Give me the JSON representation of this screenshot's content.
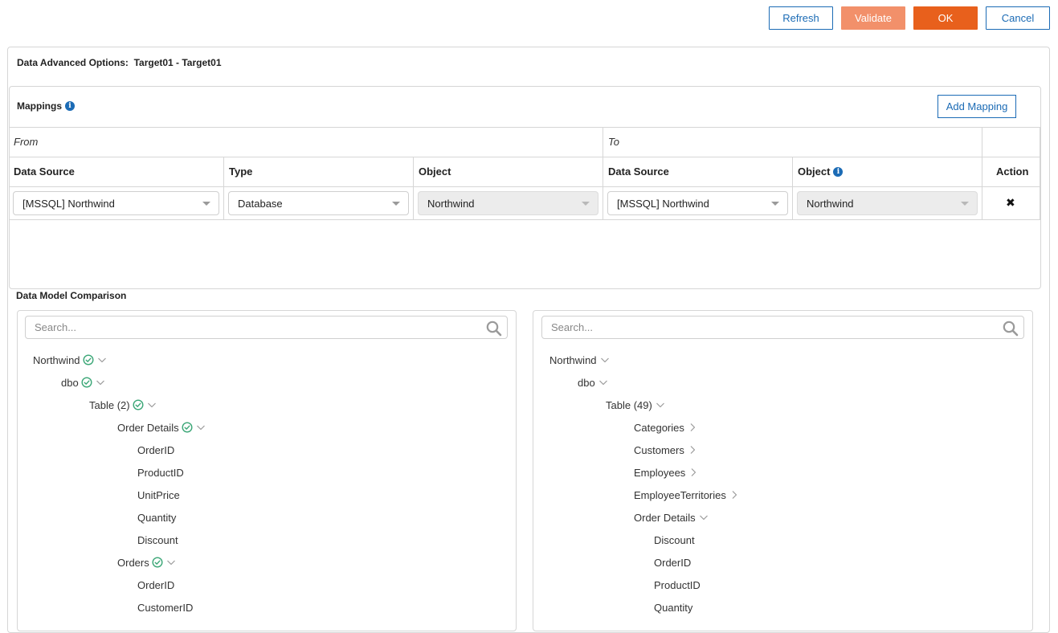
{
  "toolbar": {
    "refresh_label": "Refresh",
    "validate_label": "Validate",
    "ok_label": "OK",
    "cancel_label": "Cancel"
  },
  "panel": {
    "title": "Data Advanced Options:  Target01 - Target01"
  },
  "mappings": {
    "title": "Mappings",
    "add_label": "Add Mapping",
    "from_label": "From",
    "to_label": "To",
    "columns": {
      "from_source": "Data Source",
      "from_type": "Type",
      "from_object": "Object",
      "to_source": "Data Source",
      "to_object": "Object",
      "action": "Action"
    },
    "row": {
      "from_source": "[MSSQL] Northwind",
      "from_type": "Database",
      "from_object": "Northwind",
      "to_source": "[MSSQL] Northwind",
      "to_object": "Northwind",
      "action_symbol": "✖"
    }
  },
  "comparison": {
    "title": "Data Model Comparison",
    "left": {
      "search_placeholder": "Search...",
      "nodes": [
        {
          "label": "Northwind",
          "check": true,
          "toggle": "down"
        },
        {
          "label": "dbo",
          "check": true,
          "toggle": "down"
        },
        {
          "label": "Table (2)",
          "check": true,
          "toggle": "down"
        },
        {
          "label": "Order Details",
          "check": true,
          "toggle": "down"
        },
        {
          "label": "OrderID"
        },
        {
          "label": "ProductID"
        },
        {
          "label": "UnitPrice"
        },
        {
          "label": "Quantity"
        },
        {
          "label": "Discount"
        },
        {
          "label": "Orders",
          "check": true,
          "toggle": "down"
        },
        {
          "label": "OrderID"
        },
        {
          "label": "CustomerID"
        }
      ]
    },
    "right": {
      "search_placeholder": "Search...",
      "nodes": [
        {
          "label": "Northwind",
          "toggle": "down"
        },
        {
          "label": "dbo",
          "toggle": "down"
        },
        {
          "label": "Table (49)",
          "toggle": "down"
        },
        {
          "label": "Categories",
          "toggle": "right"
        },
        {
          "label": "Customers",
          "toggle": "right"
        },
        {
          "label": "Employees",
          "toggle": "right"
        },
        {
          "label": "EmployeeTerritories",
          "toggle": "right"
        },
        {
          "label": "Order Details",
          "toggle": "down"
        },
        {
          "label": "Discount"
        },
        {
          "label": "OrderID"
        },
        {
          "label": "ProductID"
        },
        {
          "label": "Quantity"
        }
      ]
    }
  },
  "colors": {
    "primary_blue": "#1b6bb5",
    "accent_orange": "#e8601c",
    "validate_orange": "#f2906a",
    "check_green": "#3aa676"
  },
  "icons": [
    "info-icon",
    "search-icon",
    "check-circle-icon",
    "chevron-down-icon",
    "chevron-right-icon",
    "close-icon",
    "dropdown-caret-icon"
  ]
}
